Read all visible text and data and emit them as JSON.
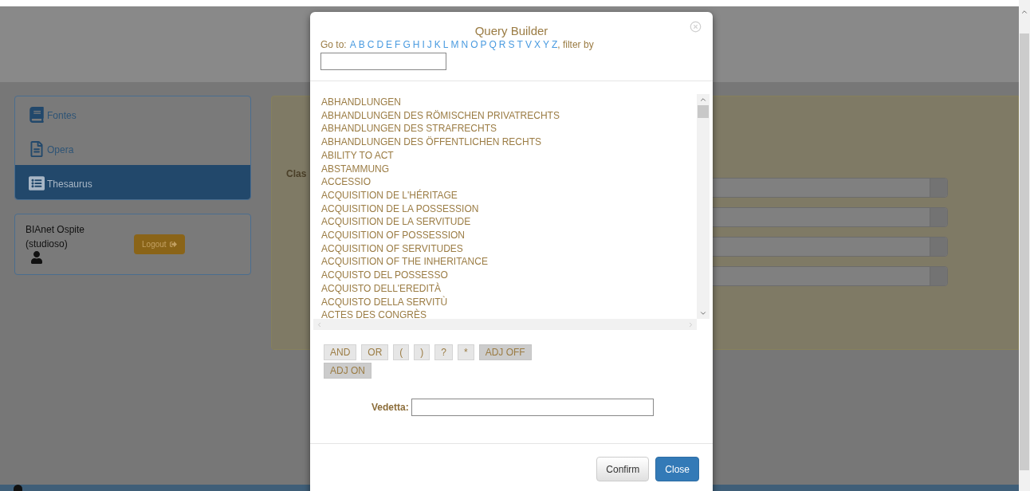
{
  "sidebar": {
    "items": [
      {
        "label": "Fontes",
        "selected": false
      },
      {
        "label": "Opera",
        "selected": false
      },
      {
        "label": "Thesaurus",
        "selected": true
      }
    ]
  },
  "user": {
    "name": "BIAnet Ospite",
    "role": "(studioso)",
    "logout": "Logout"
  },
  "form": {
    "label": "Clas",
    "fields": [
      {
        "kind": "text"
      },
      {
        "kind": "text"
      },
      {
        "kind": "text"
      },
      {
        "kind": "text"
      }
    ]
  },
  "dialog": {
    "title": "Query Builder",
    "goto_label": "Go to:",
    "letters": [
      "A",
      "B",
      "C",
      "D",
      "E",
      "F",
      "G",
      "H",
      "I",
      "J",
      "K",
      "L",
      "M",
      "N",
      "O",
      "P",
      "Q",
      "R",
      "S",
      "T",
      "V",
      "X",
      "Y",
      "Z"
    ],
    "filter_label": ", filter by",
    "terms": [
      "ABHANDLUNGEN",
      "ABHANDLUNGEN DES RÖMISCHEN PRIVATRECHTS",
      "ABHANDLUNGEN DES STRAFRECHTS",
      "ABHANDLUNGEN DES ÖFFENTLICHEN RECHTS",
      "ABILITY TO ACT",
      "ABSTAMMUNG",
      "ACCESSIO",
      "ACQUISITION DE L'HÉRITAGE",
      "ACQUISITION DE LA POSSESSION",
      "ACQUISITION DE LA SERVITUDE",
      "ACQUISITION OF POSSESSION",
      "ACQUISITION OF SERVITUDES",
      "ACQUISITION OF THE INHERITANCE",
      "ACQUISTO DEL POSSESSO",
      "ACQUISTO DELL'EREDITÀ",
      "ACQUISTO DELLA SERVITÙ",
      "ACTES DES CONGRÈS"
    ],
    "operators": [
      {
        "label": "AND",
        "kind": "operator"
      },
      {
        "label": "OR",
        "kind": "operator"
      },
      {
        "label": "(",
        "kind": "operator"
      },
      {
        "label": ")",
        "kind": "operator"
      },
      {
        "label": "?",
        "kind": "operator"
      },
      {
        "label": "*",
        "kind": "operator"
      },
      {
        "label": "ADJ OFF",
        "kind": "toggle"
      },
      {
        "label": "ADJ ON",
        "kind": "toggle"
      }
    ],
    "vedetta_label": "Vedetta:",
    "buttons": [
      {
        "label": "Confirm",
        "kind": "default"
      },
      {
        "label": "Close",
        "kind": "primary"
      }
    ]
  }
}
